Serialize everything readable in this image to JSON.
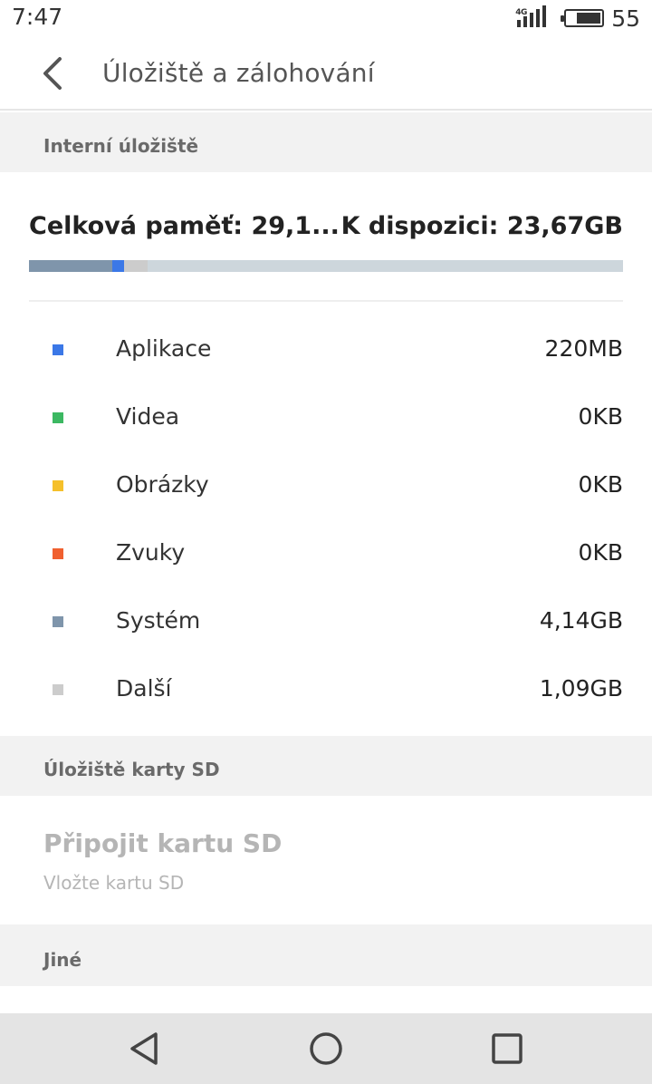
{
  "status_bar": {
    "time": "7:47",
    "network": "4G",
    "battery": "55"
  },
  "header": {
    "title": "Úložiště a zálohování",
    "back_icon": "back-arrow-icon"
  },
  "internal": {
    "section_title": "Interní úložiště",
    "total_text": "Celková paměť:  29,1...",
    "available_text": "K dispozici:  23,67GB",
    "usage_fractions": {
      "system": 0.14,
      "apps": 0.02,
      "other": 0.04
    },
    "categories": [
      {
        "label": "Aplikace",
        "value": "220MB",
        "color": "#3b78e7"
      },
      {
        "label": "Videa",
        "value": "0KB",
        "color": "#3cb862"
      },
      {
        "label": "Obrázky",
        "value": "0KB",
        "color": "#f5c02b"
      },
      {
        "label": "Zvuky",
        "value": "0KB",
        "color": "#f0602f"
      },
      {
        "label": "Systém",
        "value": "4,14GB",
        "color": "#7f95ab"
      },
      {
        "label": "Další",
        "value": "1,09GB",
        "color": "#cccccc"
      }
    ],
    "track_color": "#cdd6dc"
  },
  "sd": {
    "section_title": "Úložiště karty SD",
    "mount_title": "Připojit kartu SD",
    "mount_subtitle": "Vložte kartu SD"
  },
  "other": {
    "section_title": "Jiné"
  },
  "nav": {
    "back_icon": "triangle-back-icon",
    "home_icon": "circle-home-icon",
    "recents_icon": "square-recents-icon"
  }
}
